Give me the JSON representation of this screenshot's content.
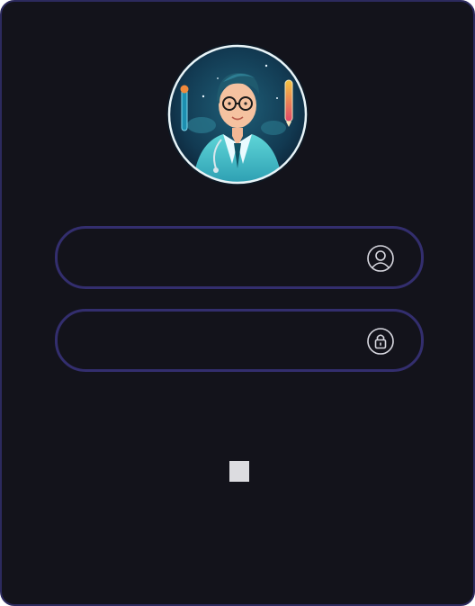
{
  "login": {
    "avatar_alt": "doctor-avatar",
    "username": {
      "value": "",
      "placeholder": "",
      "icon": "user-circle-icon"
    },
    "password": {
      "value": "",
      "placeholder": "",
      "icon": "lock-icon"
    },
    "submit_label": ""
  },
  "colors": {
    "background": "#13131b",
    "border": "#2c2a5e",
    "field_border": "#332e6e",
    "icon": "#d8d8e0",
    "button": "#dcdce0"
  }
}
